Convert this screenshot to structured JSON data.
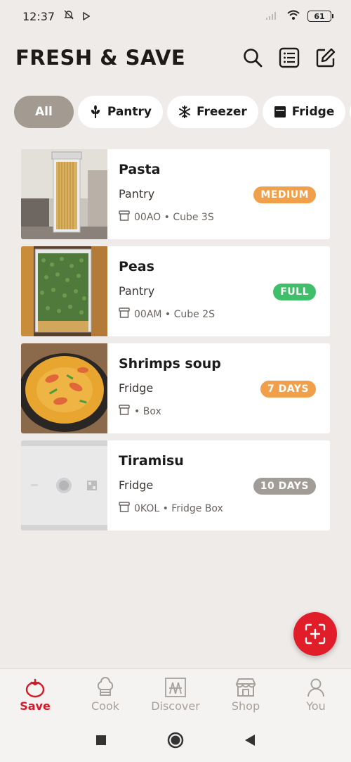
{
  "status_bar": {
    "time": "12:37",
    "battery": "61",
    "icons": [
      "bell-off-icon",
      "play-icon",
      "signal-icon",
      "wifi-icon",
      "battery-icon"
    ]
  },
  "header": {
    "title": "FRESH & SAVE",
    "actions": [
      "search-icon",
      "list-icon",
      "edit-icon"
    ]
  },
  "filters": [
    {
      "label": "All",
      "icon": "",
      "active": true
    },
    {
      "label": "Pantry",
      "icon": "wheat-icon",
      "active": false
    },
    {
      "label": "Freezer",
      "icon": "snowflake-icon",
      "active": false
    },
    {
      "label": "Fridge",
      "icon": "fridge-icon",
      "active": false
    },
    {
      "label": "",
      "icon": "wind-icon",
      "active": false
    }
  ],
  "items": [
    {
      "name": "Pasta",
      "location": "Pantry",
      "status": "MEDIUM",
      "status_color": "#f0a04b",
      "meta": "00AO • Cube 3S",
      "image": "pasta-jar-photo"
    },
    {
      "name": "Peas",
      "location": "Pantry",
      "status": "FULL",
      "status_color": "#3fbf6a",
      "meta": "00AM • Cube 2S",
      "image": "peas-jar-photo"
    },
    {
      "name": "Shrimps soup",
      "location": "Fridge",
      "status": "7 DAYS",
      "status_color": "#f0a04b",
      "meta": "• Box",
      "image": "shrimp-soup-photo"
    },
    {
      "name": "Tiramisu",
      "location": "Fridge",
      "status": "10 DAYS",
      "status_color": "#a29c96",
      "meta": "0KOL • Fridge Box",
      "image": "fridge-box-photo"
    }
  ],
  "fab": {
    "icon": "scan-add-icon"
  },
  "nav": [
    {
      "label": "Save",
      "icon": "tomato-icon",
      "active": true
    },
    {
      "label": "Cook",
      "icon": "chef-hat-icon",
      "active": false
    },
    {
      "label": "Discover",
      "icon": "discover-icon",
      "active": false
    },
    {
      "label": "Shop",
      "icon": "shop-icon",
      "active": false
    },
    {
      "label": "You",
      "icon": "user-icon",
      "active": false
    }
  ],
  "colors": {
    "accent": "#e11d2a",
    "background": "#efebe8",
    "chip_active": "#a39b91"
  }
}
